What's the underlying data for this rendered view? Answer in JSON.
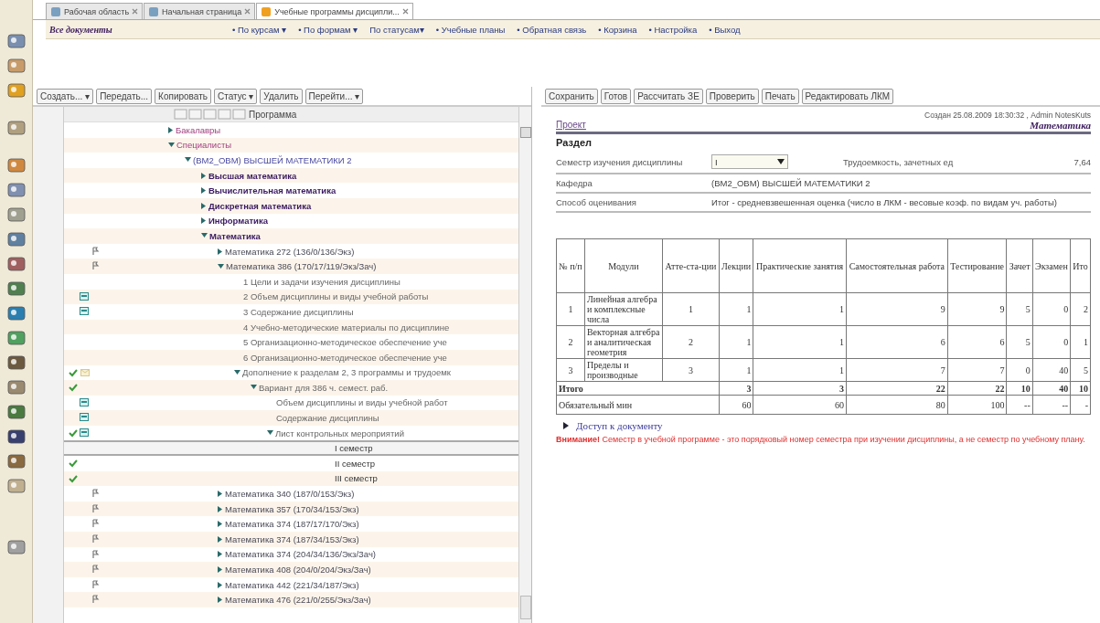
{
  "tabs": [
    {
      "label": "Рабочая область",
      "selected": false
    },
    {
      "label": "Начальная страница",
      "selected": false
    },
    {
      "label": "Учебные программы дисципли...",
      "selected": true
    }
  ],
  "nav": {
    "title": "Все документы",
    "links": [
      {
        "label": "• По курсам ▾"
      },
      {
        "label": "• По формам ▾"
      },
      {
        "label": "По статусам▾"
      },
      {
        "label": "• Учебные планы"
      },
      {
        "label": "• Обратная связь"
      },
      {
        "label": "• Корзина"
      },
      {
        "label": "• Настройка"
      },
      {
        "label": "• Выход"
      }
    ]
  },
  "left_toolbar": [
    "Создать... ▾",
    "Передать...",
    "Копировать",
    "Статус ▾",
    "Удалить",
    "Перейти... ▾"
  ],
  "tree": {
    "column": "Программа",
    "items": [
      {
        "label": "Бакалавры",
        "kind": "category",
        "expanded": false,
        "selected": false
      },
      {
        "label": "Специалисты",
        "kind": "category",
        "expanded": true,
        "selected": false,
        "children": [
          {
            "label": "(ВМ2_ОВМ) ВЫСШЕЙ МАТЕМАТИКИ 2",
            "kind": "department",
            "expanded": true,
            "selected": false,
            "children": [
              {
                "label": "Высшая математика",
                "kind": "discipline",
                "expanded": false,
                "selected": false
              },
              {
                "label": "Вычислительная математика",
                "kind": "discipline",
                "expanded": false,
                "selected": false
              },
              {
                "label": "Дискретная математика",
                "kind": "discipline",
                "expanded": false,
                "selected": false
              },
              {
                "label": "Информатика",
                "kind": "discipline",
                "expanded": false,
                "selected": false
              },
              {
                "label": "Математика",
                "kind": "discipline",
                "expanded": true,
                "selected": false,
                "children": [
                  {
                    "label": "Математика 272 (136/0/136/Экз)",
                    "kind": "program",
                    "expanded": false,
                    "selected": false,
                    "marks": [
                      {
                        "kind": "flag"
                      }
                    ]
                  },
                  {
                    "label": "Математика 386 (170/17/119/Экз/Зач)",
                    "kind": "program",
                    "expanded": true,
                    "selected": false,
                    "marks": [
                      {
                        "kind": "flag"
                      }
                    ],
                    "children": [
                      {
                        "label": "1 Цели и задачи изучения дисциплины",
                        "kind": "section",
                        "selected": false
                      },
                      {
                        "label": "2 Объем дисциплины и виды учебной работы",
                        "kind": "section",
                        "selected": false,
                        "marks": [
                          {
                            "kind": "doc"
                          }
                        ]
                      },
                      {
                        "label": "3 Содержание дисциплины",
                        "kind": "section",
                        "selected": false,
                        "marks": [
                          {
                            "kind": "doc"
                          }
                        ]
                      },
                      {
                        "label": "4 Учебно-методические материалы по дисциплине",
                        "kind": "section",
                        "selected": false
                      },
                      {
                        "label": "5 Организационно-методическое обеспечение уче",
                        "kind": "section",
                        "selected": false
                      },
                      {
                        "label": "6 Организационно-методическое обеспечение уче",
                        "kind": "section",
                        "selected": false
                      },
                      {
                        "label": "Дополнение к разделам 2, 3 программы и трудоемк",
                        "kind": "section",
                        "expanded": true,
                        "selected": false,
                        "marks": [
                          {
                            "kind": "check"
                          },
                          {
                            "kind": "mail"
                          }
                        ],
                        "children": [
                          {
                            "label": "Вариант для 386 ч. семест. раб.",
                            "kind": "section",
                            "expanded": true,
                            "selected": false,
                            "marks": [
                              {
                                "kind": "check"
                              }
                            ],
                            "children": [
                              {
                                "label": "Объем дисциплины и виды учебной работ",
                                "kind": "section",
                                "selected": false,
                                "marks": [
                                  {
                                    "kind": "doc"
                                  }
                                ]
                              },
                              {
                                "label": "Содержание дисциплины",
                                "kind": "section",
                                "selected": false,
                                "marks": [
                                  {
                                    "kind": "doc"
                                  }
                                ]
                              },
                              {
                                "label": "Лист контрольных мероприятий",
                                "kind": "section",
                                "expanded": true,
                                "selected": false,
                                "marks": [
                                  {
                                    "kind": "check"
                                  },
                                  {
                                    "kind": "doc"
                                  }
                                ],
                                "children": [
                                  {
                                    "label": "I семестр",
                                    "kind": "term",
                                    "selected": true
                                  },
                                  {
                                    "label": "II семестр",
                                    "kind": "term",
                                    "selected": false,
                                    "marks": [
                                      {
                                        "kind": "check"
                                      }
                                    ]
                                  },
                                  {
                                    "label": "III семестр",
                                    "kind": "term",
                                    "selected": false,
                                    "marks": [
                                      {
                                        "kind": "check"
                                      }
                                    ]
                                  }
                                ]
                              }
                            ]
                          }
                        ]
                      }
                    ]
                  },
                  {
                    "label": "Математика 340 (187/0/153/Экз)",
                    "kind": "program",
                    "expanded": false,
                    "selected": false,
                    "marks": [
                      {
                        "kind": "flag"
                      }
                    ]
                  },
                  {
                    "label": "Математика 357 (170/34/153/Экз)",
                    "kind": "program",
                    "expanded": false,
                    "selected": false,
                    "marks": [
                      {
                        "kind": "flag"
                      }
                    ]
                  },
                  {
                    "label": "Математика 374 (187/17/170/Экз)",
                    "kind": "program",
                    "expanded": false,
                    "selected": false,
                    "marks": [
                      {
                        "kind": "flag"
                      }
                    ]
                  },
                  {
                    "label": "Математика 374 (187/34/153/Экз)",
                    "kind": "program",
                    "expanded": false,
                    "selected": false,
                    "marks": [
                      {
                        "kind": "flag"
                      }
                    ]
                  },
                  {
                    "label": "Математика 374 (204/34/136/Экз/Зач)",
                    "kind": "program",
                    "expanded": false,
                    "selected": false,
                    "marks": [
                      {
                        "kind": "flag"
                      }
                    ]
                  },
                  {
                    "label": "Математика 408 (204/0/204/Экз/Зач)",
                    "kind": "program",
                    "expanded": false,
                    "selected": false,
                    "marks": [
                      {
                        "kind": "flag"
                      }
                    ]
                  },
                  {
                    "label": "Математика 442 (221/34/187/Экз)",
                    "kind": "program",
                    "expanded": false,
                    "selected": false,
                    "marks": [
                      {
                        "kind": "flag"
                      }
                    ]
                  },
                  {
                    "label": "Математика 476 (221/0/255/Экз/Зач)",
                    "kind": "program",
                    "expanded": false,
                    "selected": false,
                    "marks": [
                      {
                        "kind": "flag"
                      }
                    ]
                  }
                ]
              }
            ]
          }
        ]
      }
    ]
  },
  "right_toolbar": [
    "Сохранить",
    "Готов",
    "Рассчитать ЗЕ",
    "Проверить",
    "Печать",
    "Редактировать ЛКМ"
  ],
  "document": {
    "created": "Создан 25.08.2009 18:30:32 , Admin NotesKuts",
    "project_link": "Проект",
    "title": "Математика",
    "section": "Раздел",
    "semester_label": "Семестр изучения дисциплины",
    "semester_value": "I",
    "credits_label": "Трудоемкость, зачетных ед",
    "credits_value": "7,64",
    "department_label": "Кафедра",
    "department_value": "(ВМ2_ОВМ) ВЫСШЕЙ МАТЕМАТИКИ 2",
    "grading_label": "Способ оценивания",
    "grading_value": "Итог - средневзвешенная оценка (число в ЛКМ - весовые коэф. по видам уч. работы)",
    "table": {
      "columns": [
        "№ п/п",
        "Модули",
        "Атте-ста-ции",
        "Лекции",
        "Практические занятия",
        "Самостоятельная работа",
        "Тестирование",
        "Зачет",
        "Экзамен",
        "Ито"
      ],
      "rows": [
        [
          "1",
          "Линейная алгебра и комплексные числа",
          "1",
          "1",
          "1",
          "9",
          "9",
          "5",
          "0",
          "2"
        ],
        [
          "2",
          "Векторная алгебра и аналитическая геометрия",
          "2",
          "1",
          "1",
          "6",
          "6",
          "5",
          "0",
          "1"
        ],
        [
          "3",
          "Пределы и производные",
          "3",
          "1",
          "1",
          "7",
          "7",
          "0",
          "40",
          "5"
        ]
      ],
      "totals": [
        {
          "label": "Итого",
          "values": [
            "3",
            "3",
            "22",
            "22",
            "10",
            "40",
            "10"
          ]
        },
        {
          "label": "Обязательный мин",
          "values": [
            "60",
            "60",
            "80",
            "100",
            "--",
            "--",
            "-"
          ]
        }
      ]
    },
    "access_link": "Доступ к документу",
    "warning": "**Внимание!** Семестр в учебной программе - это порядковый номер семестра при изучении дисциплины, а не семестр по учебному плану."
  }
}
